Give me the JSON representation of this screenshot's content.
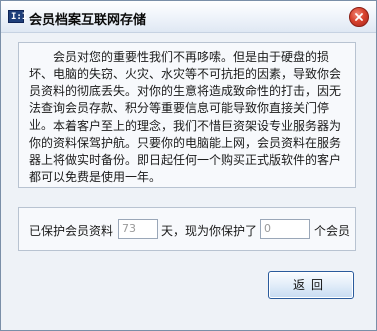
{
  "window": {
    "title": "会员档案互联网存储",
    "app_icon": "app-logo-icon",
    "app_icon_text": "I:I",
    "close_icon": "close-icon"
  },
  "info": {
    "paragraph1": "会员对您的重要性我们不再哆嗦。但是由于硬盘的损坏、电脑的失窃、火灾、水灾等不可抗拒的因素，导致你会员资料的彻底丢失。对你的生意将造成致命性的打击，因无法查询会员存款、积分等重要信息可能导致你直接关门停业。",
    "paragraph2": "本着客户至上的理念，我们不惜巨资架设专业服务器为你的资料保驾护航。只要你的电脑能上网，会员资料在服务器上将做实时备份。即日起任何一个购买正式版软件的客户都可以免费是使用一年。"
  },
  "protect": {
    "label_prefix": "已保护会员资料",
    "days_value": "73",
    "label_mid": "天，现为你保护了",
    "members_value": "0",
    "label_suffix": "个会员"
  },
  "buttons": {
    "back": "返回"
  }
}
